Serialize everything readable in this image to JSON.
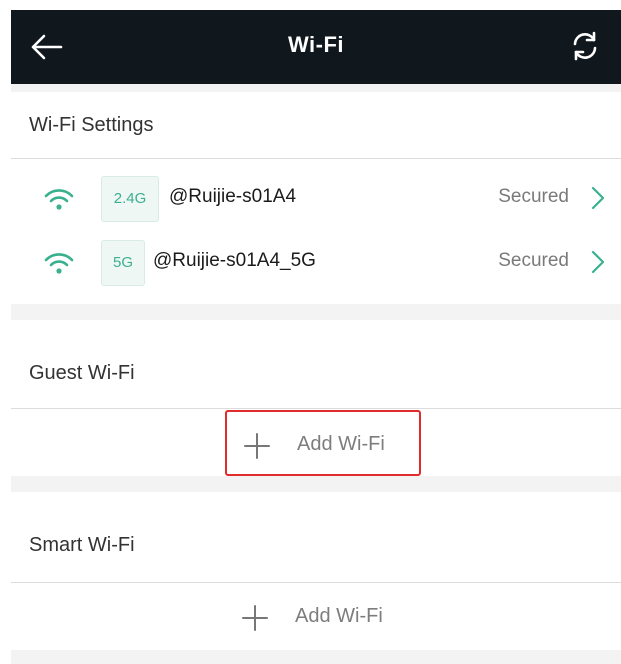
{
  "header": {
    "title": "Wi-Fi"
  },
  "wifi_settings": {
    "heading": "Wi-Fi Settings",
    "networks": [
      {
        "band": "2.4G",
        "ssid": "@Ruijie-s01A4",
        "status": "Secured"
      },
      {
        "band": "5G",
        "ssid": "@Ruijie-s01A4_5G",
        "status": "Secured"
      }
    ]
  },
  "guest_wifi": {
    "heading": "Guest Wi-Fi",
    "add_label": "Add Wi-Fi"
  },
  "smart_wifi": {
    "heading": "Smart Wi-Fi",
    "add_label": "Add Wi-Fi"
  },
  "colors": {
    "header_bg": "#10171d",
    "accent": "#3bb08f",
    "highlight": "#e22b2b"
  }
}
